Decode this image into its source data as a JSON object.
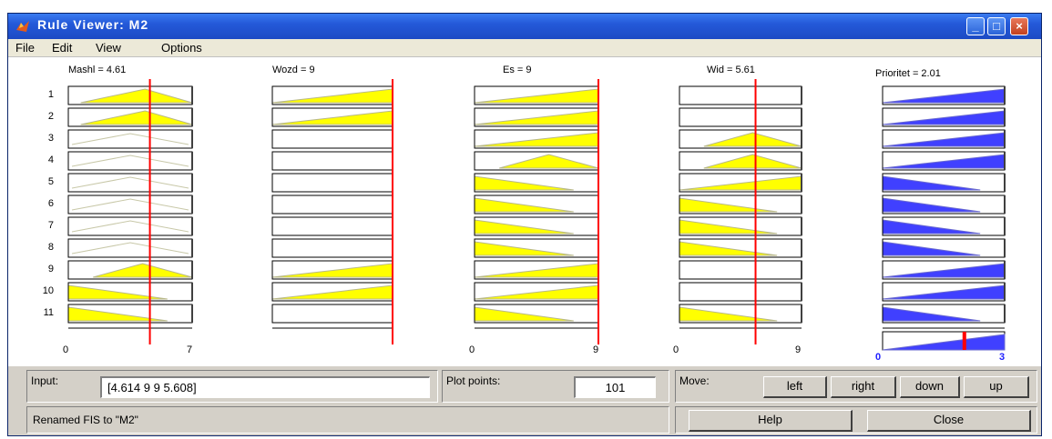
{
  "window": {
    "title": "Rule Viewer: M2"
  },
  "menu": [
    "File",
    "Edit",
    "View",
    "Options"
  ],
  "inputs": [
    {
      "title": "Mashl = 4.61",
      "range_min": "0",
      "range_max": "7",
      "value": 4.61
    },
    {
      "title": "Wozd = 9",
      "range_min": "",
      "range_max": "",
      "value": 9
    },
    {
      "title": "Es = 9",
      "range_min": "0",
      "range_max": "9",
      "value": 9
    },
    {
      "title": "Wid = 5.61",
      "range_min": "0",
      "range_max": "9",
      "value": 5.61
    }
  ],
  "output": {
    "title": "Prioritet = 2.01",
    "range_min": "0",
    "range_max": "3",
    "value": 2.01
  },
  "rules": [
    "1",
    "2",
    "3",
    "4",
    "5",
    "6",
    "7",
    "8",
    "9",
    "10",
    "11"
  ],
  "controls": {
    "input_label": "Input:",
    "input_value": "[4.614 9 9 5.608]",
    "plot_points_label": "Plot points:",
    "plot_points_value": "101",
    "move_label": "Move:",
    "left": "left",
    "right": "right",
    "down": "down",
    "up": "up",
    "help": "Help",
    "close": "Close",
    "status": "Renamed FIS to \"M2\""
  },
  "colors": {
    "input_fill": "#ffff00",
    "output_fill": "#4040ff",
    "indicator": "#ff0000",
    "titlebar": "#2459d9"
  }
}
